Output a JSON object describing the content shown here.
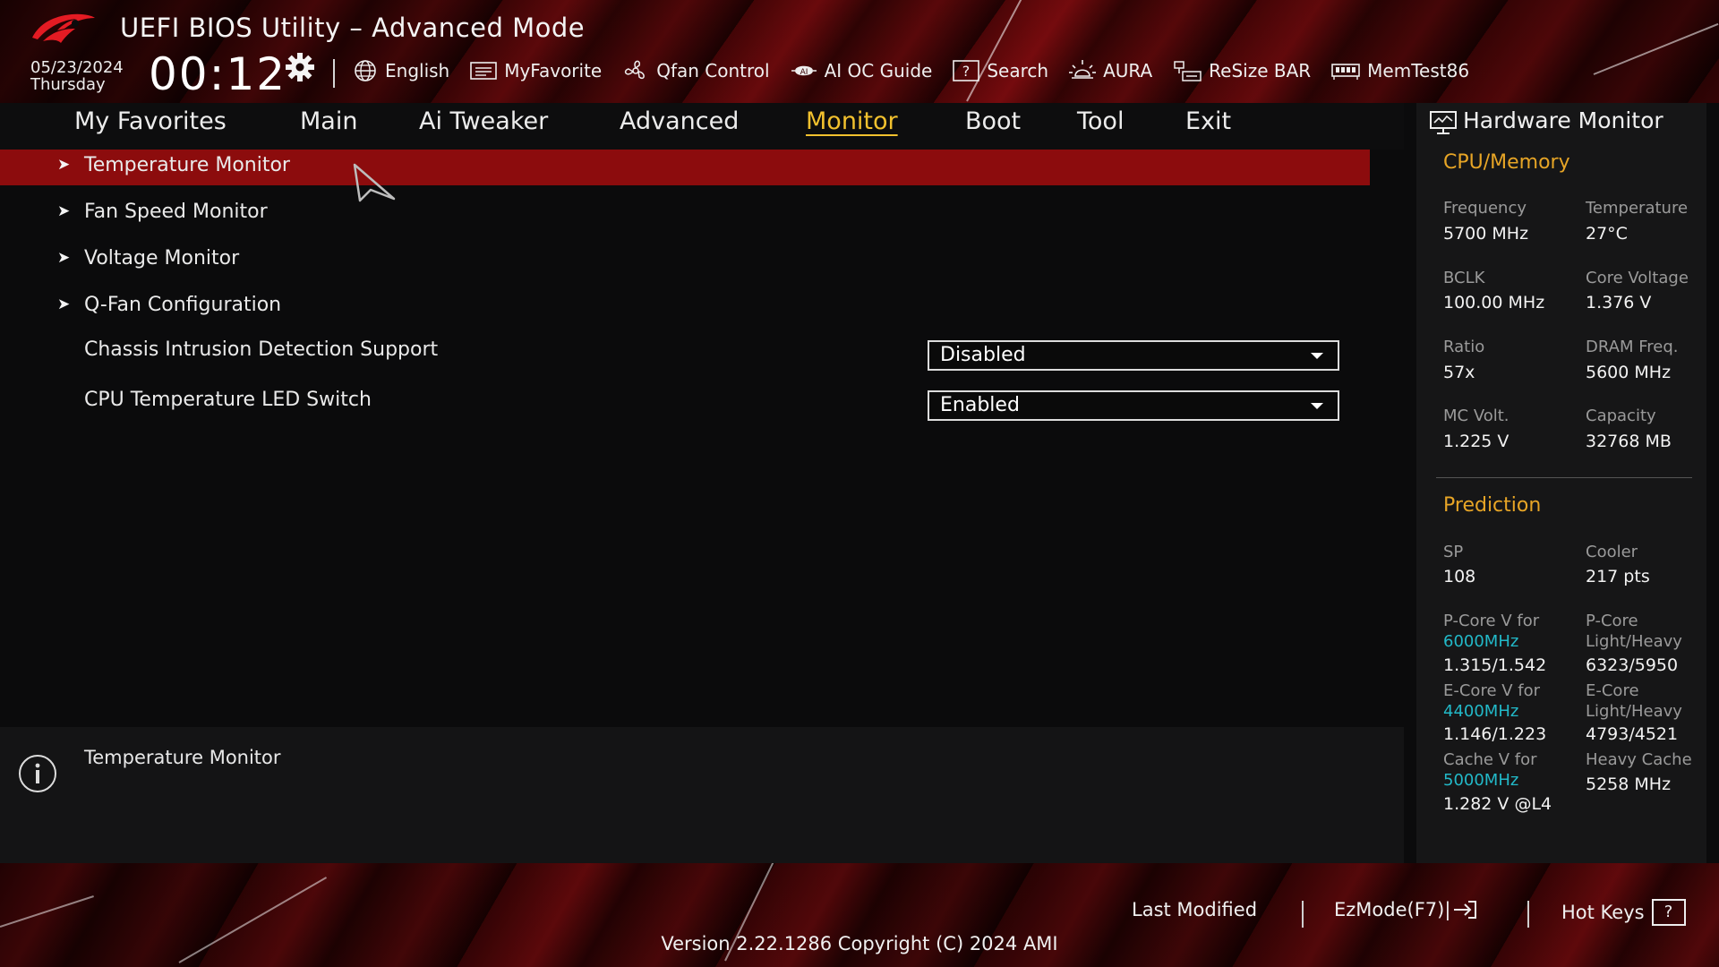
{
  "header": {
    "app_title": "UEFI BIOS Utility – Advanced Mode",
    "date": "05/23/2024",
    "day": "Thursday",
    "time": "00:12",
    "toolbar": [
      {
        "label": "English",
        "icon": "globe-icon"
      },
      {
        "label": "MyFavorite",
        "icon": "favorite-icon"
      },
      {
        "label": "Qfan Control",
        "icon": "fan-icon"
      },
      {
        "label": "AI OC Guide",
        "icon": "ai-chip-icon"
      },
      {
        "label": "Search",
        "icon": "help-search-icon"
      },
      {
        "label": "AURA",
        "icon": "aura-light-icon"
      },
      {
        "label": "ReSize BAR",
        "icon": "resize-bar-icon"
      },
      {
        "label": "MemTest86",
        "icon": "memory-icon"
      }
    ]
  },
  "tabs": [
    {
      "label": "My Favorites"
    },
    {
      "label": "Main"
    },
    {
      "label": "Ai Tweaker"
    },
    {
      "label": "Advanced"
    },
    {
      "label": "Monitor",
      "active": true
    },
    {
      "label": "Boot"
    },
    {
      "label": "Tool"
    },
    {
      "label": "Exit"
    }
  ],
  "menu": {
    "items": [
      {
        "label": "Temperature Monitor"
      },
      {
        "label": "Fan Speed Monitor"
      },
      {
        "label": "Voltage Monitor"
      },
      {
        "label": "Q-Fan Configuration"
      }
    ],
    "settings": [
      {
        "label": "Chassis Intrusion Detection Support",
        "value": "Disabled"
      },
      {
        "label": "CPU Temperature LED Switch",
        "value": "Enabled"
      }
    ]
  },
  "help": {
    "text": "Temperature Monitor"
  },
  "hardware_monitor": {
    "title": "Hardware Monitor",
    "cpu_memory": {
      "title": "CPU/Memory",
      "frequency_label": "Frequency",
      "frequency": "5700 MHz",
      "temperature_label": "Temperature",
      "temperature": "27°C",
      "bclk_label": "BCLK",
      "bclk": "100.00 MHz",
      "core_voltage_label": "Core Voltage",
      "core_voltage": "1.376 V",
      "ratio_label": "Ratio",
      "ratio": "57x",
      "dram_freq_label": "DRAM Freq.",
      "dram_freq": "5600 MHz",
      "mc_volt_label": "MC Volt.",
      "mc_volt": "1.225 V",
      "capacity_label": "Capacity",
      "capacity": "32768 MB"
    },
    "prediction": {
      "title": "Prediction",
      "sp_label": "SP",
      "sp": "108",
      "cooler_label": "Cooler",
      "cooler": "217 pts",
      "pcore_v_label": "P-Core V for",
      "pcore_v_freq": "6000MHz",
      "pcore_v": "1.315/1.542",
      "pcore_lh_label1": "P-Core",
      "pcore_lh_label2": "Light/Heavy",
      "pcore_lh": "6323/5950",
      "ecore_v_label": "E-Core V for",
      "ecore_v_freq": "4400MHz",
      "ecore_v": "1.146/1.223",
      "ecore_lh_label1": "E-Core",
      "ecore_lh_label2": "Light/Heavy",
      "ecore_lh": "4793/4521",
      "cache_v_label": "Cache V for",
      "cache_v_freq": "5000MHz",
      "cache_v": "1.282 V @L4",
      "heavy_cache_label": "Heavy Cache",
      "heavy_cache": "5258 MHz"
    }
  },
  "footer": {
    "last_modified": "Last Modified",
    "ezmode": "EzMode(F7)|",
    "hot_keys": "Hot Keys",
    "hot_keys_key": "?",
    "version": "Version 2.22.1286 Copyright (C) 2024 AMI"
  },
  "colors": {
    "accent_red": "#8c0c0d",
    "active_tab": "#f2c12e",
    "section_title": "#e7a526",
    "teal_value": "#22b9c8"
  }
}
